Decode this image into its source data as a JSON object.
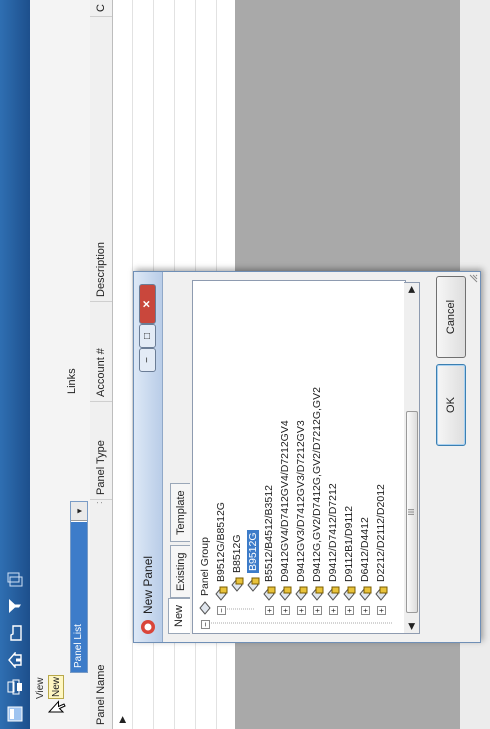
{
  "toolbar": {
    "icons": [
      "app-icon",
      "print-icon",
      "home-icon",
      "folder-icon",
      "filter-icon",
      "copy-icon"
    ]
  },
  "header": {
    "view_label": "View",
    "new_badge": "New",
    "panel_list_value": "Panel List",
    "links_label": "Links"
  },
  "grid": {
    "columns": [
      "Panel Name",
      "Panel Type",
      "Account #",
      "Description",
      "C"
    ],
    "sort_marker": ":",
    "row_marker": "▶"
  },
  "dialog": {
    "title": "New Panel",
    "tabs": [
      "New",
      "Existing",
      "Template"
    ],
    "tree": [
      {
        "label": "Panel Group",
        "level": 0,
        "expander": "−"
      },
      {
        "label": "B9512G/B8512G",
        "level": 1,
        "expander": "−"
      },
      {
        "label": "B8512G",
        "level": 2,
        "expander": ""
      },
      {
        "label": "B9512G",
        "level": 2,
        "expander": "",
        "selected": true
      },
      {
        "label": "B5512/B4512/B3512",
        "level": 1,
        "expander": "+"
      },
      {
        "label": "D9412GV4/D7412GV4/D7212GV4",
        "level": 1,
        "expander": "+"
      },
      {
        "label": "D9412GV3/D7412GV3/D7212GV3",
        "level": 1,
        "expander": "+"
      },
      {
        "label": "D9412G,GV2/D7412G,GV2/D7212G,GV2",
        "level": 1,
        "expander": "+"
      },
      {
        "label": "D9412/D7412/D7212",
        "level": 1,
        "expander": "+"
      },
      {
        "label": "D9112B1/D9112",
        "level": 1,
        "expander": "+"
      },
      {
        "label": "D6412/D4412",
        "level": 1,
        "expander": "+"
      },
      {
        "label": "D2212/D2112/D2012",
        "level": 1,
        "expander": "+"
      }
    ],
    "scroll_grip": "III",
    "ok_label": "OK",
    "cancel_label": "Cancel",
    "minimize_glyph": "−",
    "maximize_glyph": "□",
    "close_glyph": "✕"
  }
}
